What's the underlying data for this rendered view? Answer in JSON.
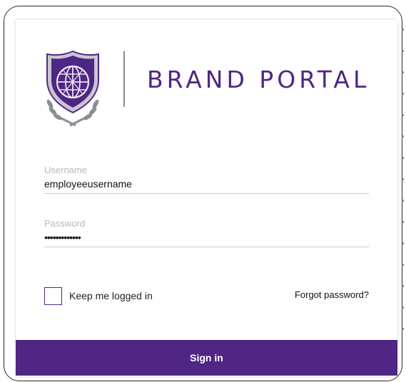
{
  "brand": {
    "title": "BRAND PORTAL",
    "logo_icon": "shield-crest-icon",
    "accent_color": "#4f2683"
  },
  "form": {
    "username_label": "Username",
    "username_value": "employeeusername",
    "password_label": "Password",
    "password_value": "•••••••••••••",
    "remember_label": "Keep me logged in",
    "remember_checked": false,
    "forgot_label": "Forgot password?",
    "signin_label": "Sign in"
  }
}
